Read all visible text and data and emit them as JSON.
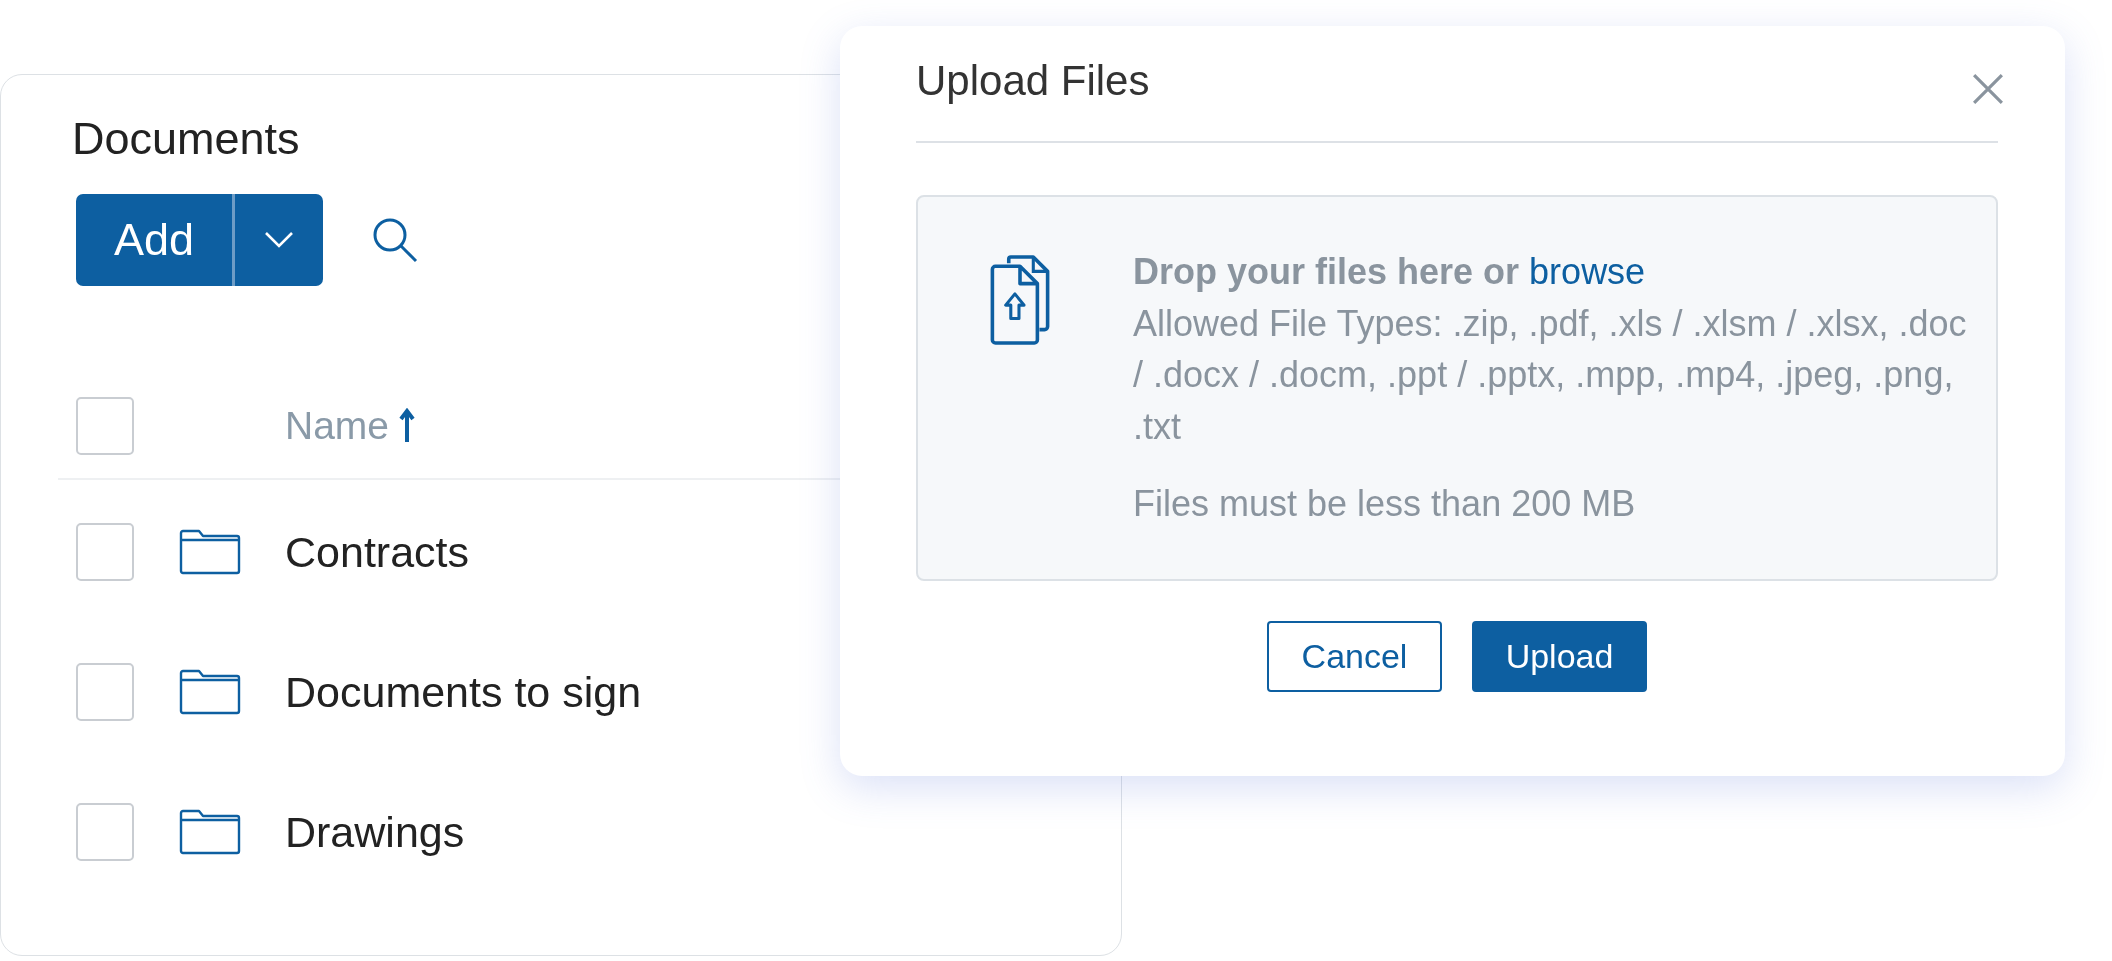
{
  "documents": {
    "title": "Documents",
    "add_button": "Add",
    "name_column": {
      "label": "Name",
      "sort_ascending": true
    },
    "select_all": {
      "checked": false
    },
    "rows": [
      {
        "name": "Contracts",
        "kind": "folder",
        "checked": false
      },
      {
        "name": "Documents to sign",
        "kind": "folder",
        "checked": false
      },
      {
        "name": "Drawings",
        "kind": "folder",
        "checked": false
      }
    ]
  },
  "dialog": {
    "title": "Upload Files",
    "drop_prompt": "Drop your files here or",
    "browse_link": "browse",
    "allowed_types": "Allowed File Types: .zip, .pdf, .xls / .xlsm / .xlsx, .doc / .docx / .docm, .ppt / .pptx, .mpp, .mp4, .jpeg, .png, .txt",
    "size_limit": "Files must be less than 200 MB",
    "buttons": [
      {
        "label": "Cancel",
        "kind": "secondary"
      },
      {
        "label": "Upload",
        "kind": "primary"
      }
    ]
  }
}
